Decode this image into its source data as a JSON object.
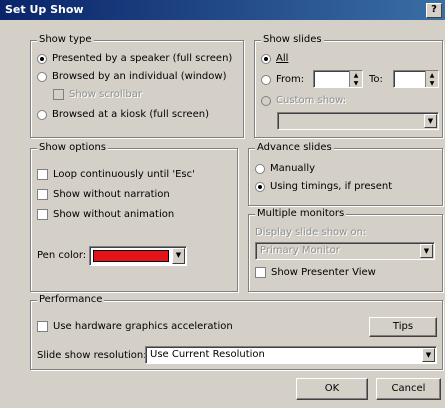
{
  "window": {
    "title": "Set Up Show",
    "help_button": "?"
  },
  "show_type": {
    "legend": "Show type",
    "options": [
      "Presented by a speaker (full screen)",
      "Browsed by an individual (window)",
      "Browsed at a kiosk (full screen)"
    ],
    "show_scrollbar": "Show scrollbar"
  },
  "show_slides": {
    "legend": "Show slides",
    "all": "All",
    "from": "From:",
    "from_value": "",
    "to": "To:",
    "to_value": "",
    "custom_show": "Custom show:"
  },
  "show_options": {
    "legend": "Show options",
    "loop": "Loop continuously until 'Esc'",
    "without_narration": "Show without narration",
    "without_animation": "Show without animation",
    "pen_color": "Pen color:",
    "pen_color_value": "#e2141a"
  },
  "advance_slides": {
    "legend": "Advance slides",
    "manually": "Manually",
    "using_timings": "Using timings, if present"
  },
  "multiple_monitors": {
    "legend": "Multiple monitors",
    "display_on": "Display slide show on:",
    "display_value": "Primary Monitor",
    "presenter_view": "Show Presenter View"
  },
  "performance": {
    "legend": "Performance",
    "hardware_accel": "Use hardware graphics acceleration",
    "tips": "Tips",
    "resolution_label": "Slide show resolution:",
    "resolution_value": "Use Current Resolution"
  },
  "buttons": {
    "ok": "OK",
    "cancel": "Cancel"
  }
}
